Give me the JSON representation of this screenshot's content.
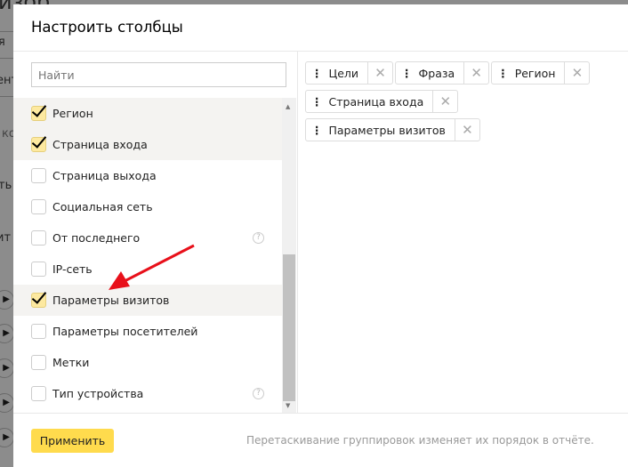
{
  "background": {
    "fragments": [
      "изор",
      "я",
      "ент",
      "ко",
      "ть",
      "ит"
    ]
  },
  "modal": {
    "title": "Настроить столбцы",
    "search": {
      "placeholder": "Найти",
      "value": ""
    },
    "items": [
      {
        "label": "Регион",
        "checked": true,
        "help": false
      },
      {
        "label": "Страница входа",
        "checked": true,
        "help": false
      },
      {
        "label": "Страница выхода",
        "checked": false,
        "help": false
      },
      {
        "label": "Социальная сеть",
        "checked": false,
        "help": false
      },
      {
        "label": "От последнего",
        "checked": false,
        "help": true
      },
      {
        "label": "IP-сеть",
        "checked": false,
        "help": false
      },
      {
        "label": "Параметры визитов",
        "checked": true,
        "help": false
      },
      {
        "label": "Параметры посетителей",
        "checked": false,
        "help": false
      },
      {
        "label": "Метки",
        "checked": false,
        "help": false
      },
      {
        "label": "Тип устройства",
        "checked": false,
        "help": true
      }
    ],
    "selected": [
      "Цели",
      "Фраза",
      "Регион",
      "Страница входа",
      "Параметры визитов"
    ],
    "apply_label": "Применить",
    "hint": "Перетаскивание группировок изменяет их порядок в отчёте.",
    "accent": "#ffdb4d",
    "annotation_arrow_color": "#e8101a"
  }
}
